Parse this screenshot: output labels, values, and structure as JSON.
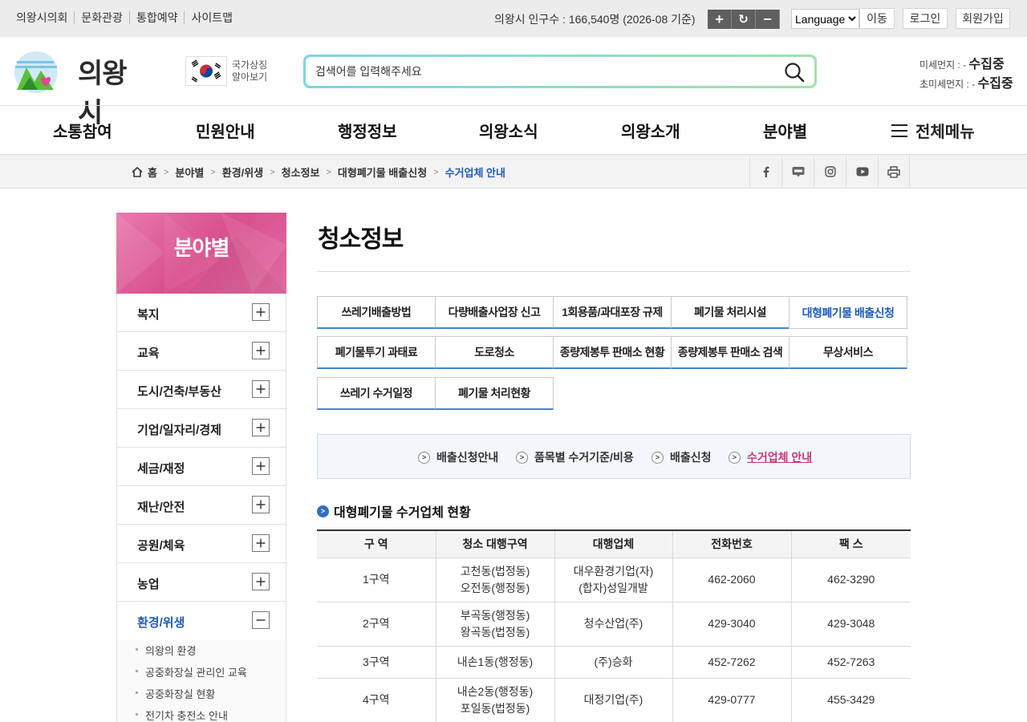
{
  "util": {
    "links": [
      "의왕시의회",
      "문화관광",
      "통합예약",
      "사이트맵"
    ],
    "population": "의왕시 인구수 : 166,540명 (2026-08 기준)",
    "zoom_in": "+",
    "zoom_reset": "↻",
    "zoom_out": "−",
    "language": "Language",
    "go": "이동",
    "login": "로그인",
    "join": "회원가입"
  },
  "header": {
    "logo_text": "의왕시",
    "symbol_line1": "국가상징",
    "symbol_line2": "알아보기",
    "search_placeholder": "검색어를 입력해주세요",
    "dust_label": "미세먼지 : -",
    "dust_value": "수집중",
    "ultrafine_label": "초미세먼지 : -",
    "ultrafine_value": "수집중"
  },
  "gnb": {
    "items": [
      "소통참여",
      "민원안내",
      "행정정보",
      "의왕소식",
      "의왕소개",
      "분야별"
    ],
    "all_menu": "전체메뉴"
  },
  "breadcrumb": {
    "home": "홈",
    "items": [
      "분야별",
      "환경/위생",
      "청소정보",
      "대형폐기물 배출신청"
    ],
    "current": "수거업체 안내"
  },
  "sns": [
    "facebook-icon",
    "blog-icon",
    "instagram-icon",
    "youtube-icon",
    "print-icon"
  ],
  "lnb": {
    "title": "분야별",
    "items": [
      "복지",
      "교육",
      "도시/건축/부동산",
      "기업/일자리/경제",
      "세금/재정",
      "재난/안전",
      "공원/체육",
      "농업",
      "환경/위생"
    ],
    "sub_items": [
      "의왕의 환경",
      "공중화장실 관리인 교육",
      "공중화장실 현황",
      "전기차 충전소 안내"
    ]
  },
  "content": {
    "title": "청소정보",
    "tabs": [
      "쓰레기배출방법",
      "다량배출사업장 신고",
      "1회용품/과대포장 규제",
      "폐기물 처리시설",
      "대형폐기물 배출신청",
      "폐기물투기 과태료",
      "도로청소",
      "종량제봉투 판매소 현황",
      "종량제봉투 판매소 검색",
      "무상서비스",
      "쓰레기 수거일정",
      "폐기물 처리현황"
    ],
    "subtabs": [
      "배출신청안내",
      "품목별 수거기준/비용",
      "배출신청",
      "수거업체 안내"
    ],
    "section_title": "대형폐기물 수거업체 현황",
    "table_headers": [
      "구 역",
      "청소 대행구역",
      "대행업체",
      "전화번호",
      "팩 스"
    ],
    "rows": [
      {
        "zone": "1구역",
        "area1": "고천동(법정동)",
        "area2": "오전동(행정동)",
        "company1": "대우환경기업(자)",
        "company2": "(합자)성일개발",
        "tel": "462-2060",
        "fax": "462-3290"
      },
      {
        "zone": "2구역",
        "area1": "부곡동(행정동)",
        "area2": "왕곡동(법정동)",
        "company1": "청수산업(주)",
        "company2": "",
        "tel": "429-3040",
        "fax": "429-3048"
      },
      {
        "zone": "3구역",
        "area1": "내손1동(행정동)",
        "area2": "",
        "company1": "(주)승화",
        "company2": "",
        "tel": "452-7262",
        "fax": "452-7263"
      },
      {
        "zone": "4구역",
        "area1": "내손2동(행정동)",
        "area2": "포일동(법정동)",
        "company1": "대정기업(주)",
        "company2": "",
        "tel": "429-0777",
        "fax": "455-3429"
      }
    ]
  }
}
